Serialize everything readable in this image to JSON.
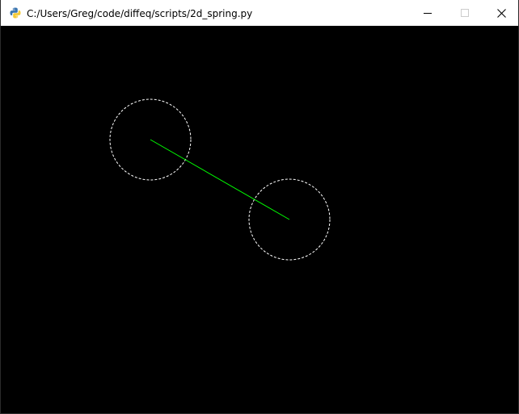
{
  "window": {
    "title": "C:/Users/Greg/code/diffeq/scripts/2d_spring.py",
    "icon": "python-icon",
    "controls": {
      "minimize": "minimize-icon",
      "maximize": "maximize-icon",
      "close": "close-icon"
    }
  },
  "scene": {
    "background_color": "#000000",
    "spring_color": "#00ff00",
    "mass_outline_color": "#ffffff",
    "mass_outline_style": "dashed",
    "masses": [
      {
        "name": "mass-1"
      },
      {
        "name": "mass-2"
      }
    ]
  }
}
